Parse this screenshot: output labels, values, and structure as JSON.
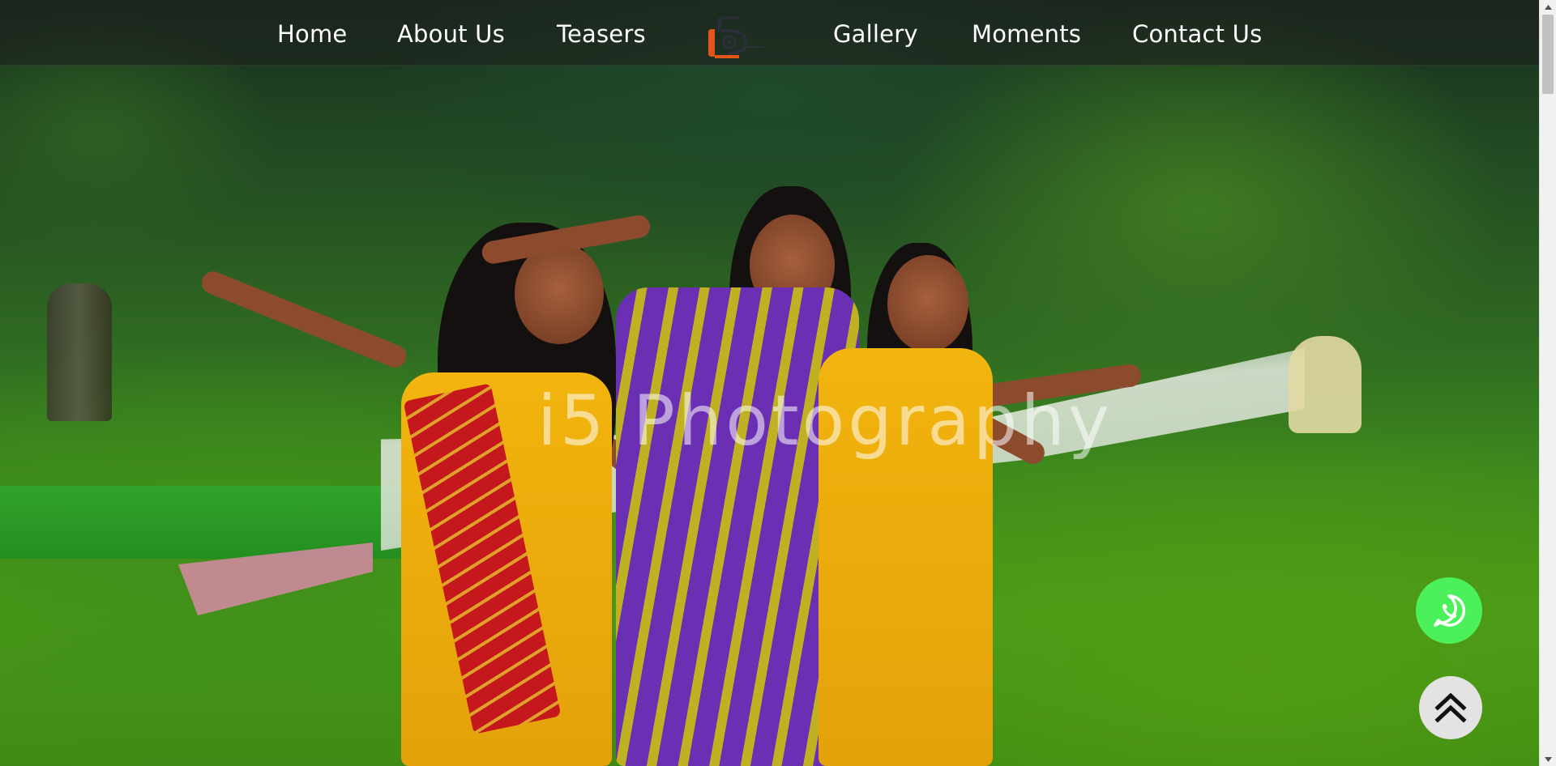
{
  "nav": {
    "items": [
      {
        "label": "Home"
      },
      {
        "label": "About Us"
      },
      {
        "label": "Teasers"
      },
      {
        "label": "Gallery"
      },
      {
        "label": "Moments"
      },
      {
        "label": "Contact Us"
      }
    ],
    "logo_icon": "camera-i5-logo"
  },
  "hero": {
    "watermark": "i5 Photography"
  },
  "floating": {
    "whatsapp_icon": "whatsapp-icon",
    "whatsapp_color": "#4cf05a",
    "scroll_top_icon": "double-chevron-up-icon"
  }
}
